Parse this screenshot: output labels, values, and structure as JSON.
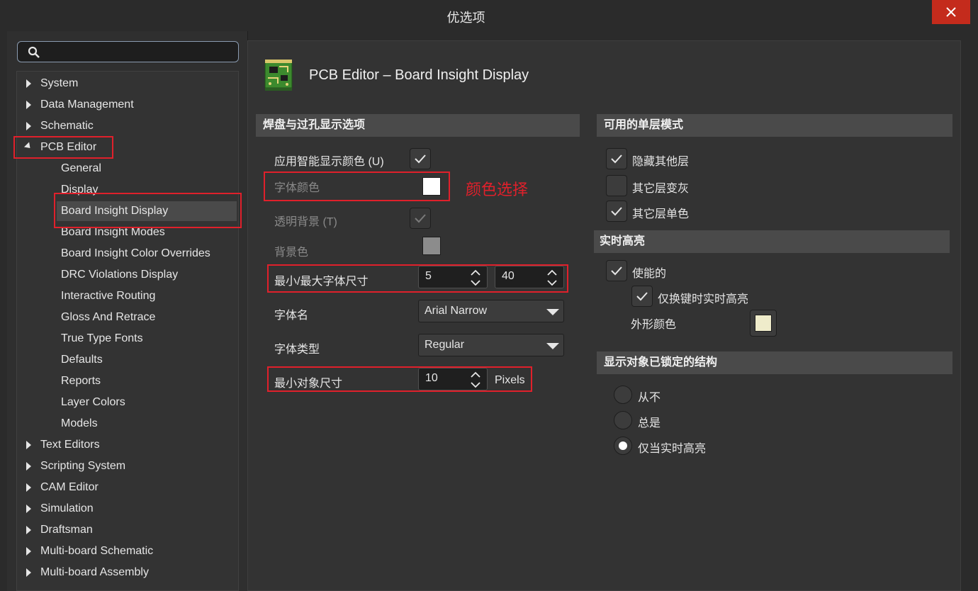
{
  "window": {
    "title": "优选项"
  },
  "search": {
    "placeholder": ""
  },
  "tree": {
    "top": [
      "System",
      "Data Management",
      "Schematic",
      "PCB Editor"
    ],
    "pcb_children": [
      "General",
      "Display",
      "Board Insight Display",
      "Board Insight Modes",
      "Board Insight Color Overrides",
      "DRC Violations Display",
      "Interactive Routing",
      "Gloss And Retrace",
      "True Type Fonts",
      "Defaults",
      "Reports",
      "Layer Colors",
      "Models"
    ],
    "bottom": [
      "Text Editors",
      "Scripting System",
      "CAM Editor",
      "Simulation",
      "Draftsman",
      "Multi-board Schematic",
      "Multi-board Assembly"
    ],
    "selected": "Board Insight Display"
  },
  "header": {
    "title": "PCB Editor – Board Insight Display"
  },
  "pad_via": {
    "section": "焊盘与过孔显示选项",
    "smart_color": "应用智能显示颜色 (U)",
    "font_color": "字体颜色",
    "font_color_value": "#ffffff",
    "transparent_bg": "透明背景 (T)",
    "bg_color": "背景色",
    "bg_color_value": "#8c8c8c",
    "min_max_font": "最小/最大字体尺寸",
    "min_font": "5",
    "max_font": "40",
    "font_name_label": "字体名",
    "font_name": "Arial Narrow",
    "font_style_label": "字体类型",
    "font_style": "Regular",
    "min_obj_label": "最小对象尺寸",
    "min_obj": "10",
    "min_obj_unit": "Pixels"
  },
  "annotation": "颜色选择",
  "single_layer": {
    "section": "可用的单层模式",
    "hide_others": "隐藏其他层",
    "gray_others": "其它层变灰",
    "mono_others": "其它层单色"
  },
  "live_highlight": {
    "section": "实时高亮",
    "enabled": "使能的",
    "shift_only": "仅换键时实时高亮",
    "outline_color": "外形颜色",
    "outline_color_value": "#efeccb"
  },
  "locked": {
    "section": "显示对象已锁定的结构",
    "options": [
      "从不",
      "总是",
      "仅当实时高亮"
    ],
    "selected_index": 2
  },
  "colors": {
    "accent_red": "#e0202b",
    "close_red": "#c42b1c"
  }
}
